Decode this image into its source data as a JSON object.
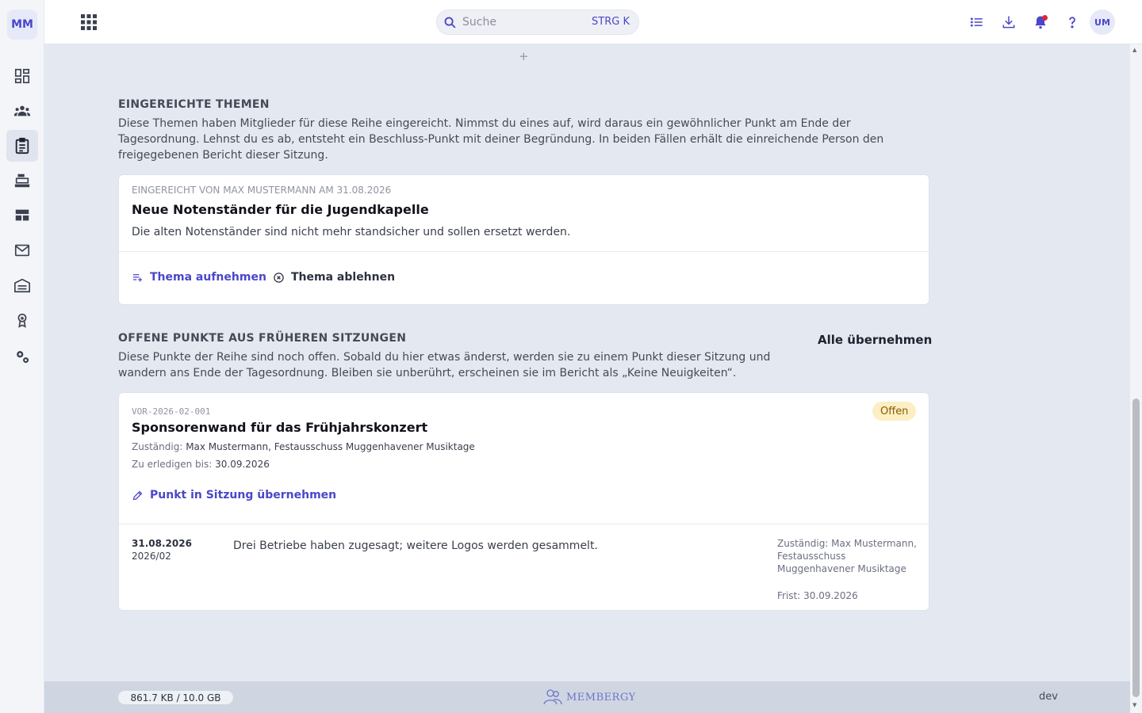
{
  "app": {
    "logo_text": "MM",
    "user_initials": "UM",
    "brand_name": "MEMBERGY",
    "accent_color": "#4a47c9"
  },
  "sidebar": {
    "items": [
      {
        "name": "dashboard",
        "icon": "dashboard-icon",
        "active": false
      },
      {
        "name": "members",
        "icon": "group-icon",
        "active": false
      },
      {
        "name": "meetings",
        "icon": "clipboard-icon",
        "active": true
      },
      {
        "name": "inventory",
        "icon": "cash-register-icon",
        "active": false
      },
      {
        "name": "layout",
        "icon": "table-icon",
        "active": false
      },
      {
        "name": "mail",
        "icon": "mail-icon",
        "active": false
      },
      {
        "name": "warehouse",
        "icon": "warehouse-icon",
        "active": false
      },
      {
        "name": "awards",
        "icon": "medal-icon",
        "active": false
      },
      {
        "name": "settings",
        "icon": "gears-icon",
        "active": false
      }
    ]
  },
  "topbar": {
    "search_placeholder": "Suche",
    "search_shortcut": "STRG K",
    "icons": [
      "list-icon",
      "download-icon",
      "bell-icon",
      "help-icon"
    ],
    "has_notification": true
  },
  "submitted": {
    "title": "EINGEREICHTE THEMEN",
    "description": "Diese Themen haben Mitglieder für diese Reihe eingereicht. Nimmst du eines auf, wird daraus ein gewöhnlicher Punkt am Ende der Tagesordnung. Lehnst du es ab, entsteht ein Beschluss-Punkt mit deiner Begründung. In beiden Fällen erhält die einreichende Person den freigegebenen Bericht dieser Sitzung.",
    "card": {
      "meta": "EINGEREICHT VON MAX MUSTERMANN AM 31.08.2026",
      "title": "Neue Notenständer für die Jugendkapelle",
      "text": "Die alten Notenständer sind nicht mehr standsicher und sollen ersetzt werden.",
      "accept_label": "Thema aufnehmen",
      "reject_label": "Thema ablehnen"
    }
  },
  "open_items": {
    "title": "OFFENE PUNKTE AUS FRÜHEREN SITZUNGEN",
    "accept_all_label": "Alle übernehmen",
    "description": "Diese Punkte der Reihe sind noch offen. Sobald du hier etwas änderst, werden sie zu einem Punkt dieser Sitzung und wandern ans Ende der Tagesordnung. Bleiben sie unberührt, erscheinen sie im Bericht als „Keine Neuigkeiten“.",
    "card": {
      "code": "VOR-2026-02-001",
      "title": "Sponsorenwand für das Frühjahrskonzert",
      "status": "Offen",
      "status_color": "#fcefc4",
      "responsible_label": "Zuständig:",
      "responsible_value": "Max Mustermann, Festausschuss Muggenhavener Musiktage",
      "due_label": "Zu erledigen bis:",
      "due_value": "30.09.2026",
      "take_over_label": "Punkt in Sitzung übernehmen",
      "history": {
        "date": "31.08.2026",
        "session": "2026/02",
        "text": "Drei Betriebe haben zugesagt; weitere Logos werden gesammelt.",
        "responsible": "Zuständig: Max Mustermann, Festausschuss Muggenhavener Musiktage",
        "deadline": "Frist: 30.09.2026"
      }
    }
  },
  "footer": {
    "storage": "861.7 KB / 10.0 GB",
    "environment": "dev"
  }
}
